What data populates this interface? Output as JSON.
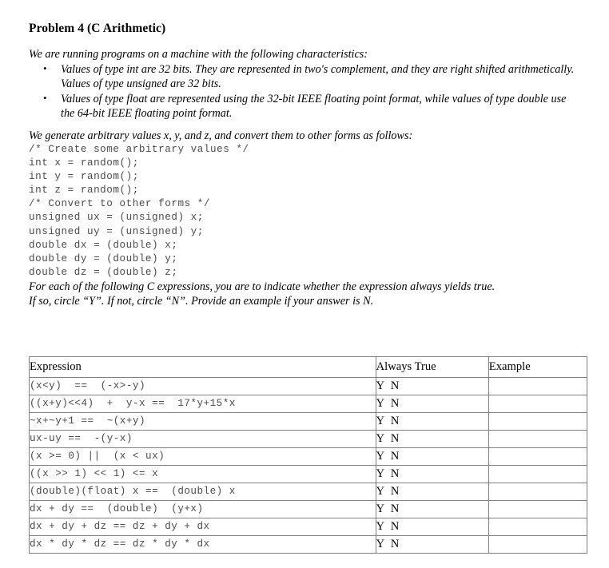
{
  "document": {
    "title": "Problem 4 (C Arithmetic)",
    "intro": "We are running programs on a machine with the following characteristics:",
    "bullets": [
      "Values of type int are 32 bits. They are represented in two's complement, and they are right shifted arithmetically. Values of type unsigned are 32 bits.",
      "Values of type float are represented using the 32-bit IEEE floating point format, while values of type double use the 64-bit IEEE floating point format."
    ],
    "generate_line": "We generate arbitrary values x, y, and z, and convert them to other forms as follows:",
    "code": [
      "/* Create some arbitrary values */",
      "int x = random();",
      "int y = random();",
      "int z = random();",
      "/* Convert to other forms */",
      "unsigned ux = (unsigned) x;",
      "unsigned uy = (unsigned) y;",
      "double dx = (double) x;",
      "double dy = (double) y;",
      "double dz = (double) z;"
    ],
    "instructions_line1": "For each of the following C expressions, you are to indicate whether the expression always yields true.",
    "instructions_line2": "If so, circle “Y”. If not, circle “N”. Provide an example if your answer is N."
  },
  "table": {
    "headers": [
      "Expression",
      "Always True",
      "Example"
    ],
    "rows": [
      {
        "expression": "(x<y)  ==  (-x>-y)",
        "always_true": "Y  N",
        "example": ""
      },
      {
        "expression": "((x+y)<<4)  +  y-x ==  17*y+15*x",
        "always_true": "Y  N",
        "example": ""
      },
      {
        "expression": "~x+~y+1 ==  ~(x+y)",
        "always_true": "Y  N",
        "example": ""
      },
      {
        "expression": "ux-uy ==  -(y-x)",
        "always_true": "Y  N",
        "example": ""
      },
      {
        "expression": "(x >= 0) ||  (x < ux)",
        "always_true": "Y  N",
        "example": ""
      },
      {
        "expression": "((x >> 1) << 1) <= x",
        "always_true": "Y  N",
        "example": ""
      },
      {
        "expression": "(double)(float) x ==  (double) x",
        "always_true": "Y  N",
        "example": ""
      },
      {
        "expression": "dx + dy ==  (double)  (y+x)",
        "always_true": "Y  N",
        "example": ""
      },
      {
        "expression": "dx + dy + dz == dz + dy + dx",
        "always_true": "Y  N",
        "example": ""
      },
      {
        "expression": "dx * dy * dz == dz * dy * dx",
        "always_true": "Y  N",
        "example": ""
      }
    ]
  }
}
